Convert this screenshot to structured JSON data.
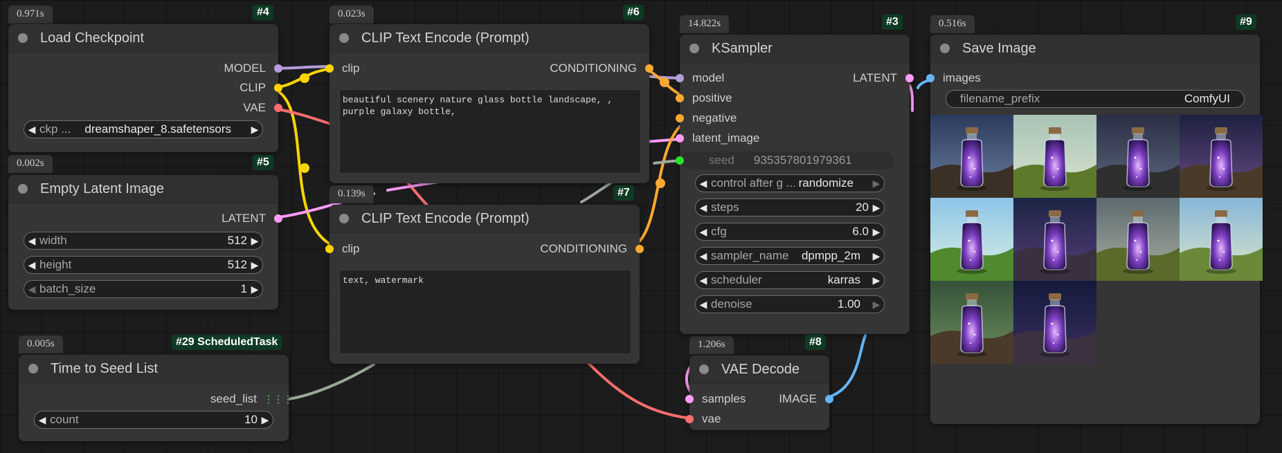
{
  "colors": {
    "model": "#b39ddb",
    "clip": "#ffd500",
    "vae": "#ff6e6e",
    "latent": "#ff9cf9",
    "conditioning": "#ffa931",
    "image": "#64b5f6",
    "int": "#29a329",
    "seedlist": "#4caf50"
  },
  "nodes": {
    "load_checkpoint": {
      "time": "0.971s",
      "id": "#4",
      "title": "Load Checkpoint",
      "outputs": [
        "MODEL",
        "CLIP",
        "VAE"
      ],
      "ckpt_name": "ckp ...",
      "ckpt_value": "dreamshaper_8.safetensors"
    },
    "empty_latent": {
      "time": "0.002s",
      "id": "#5",
      "title": "Empty Latent Image",
      "output": "LATENT",
      "widgets": [
        {
          "name": "width",
          "value": "512"
        },
        {
          "name": "height",
          "value": "512"
        },
        {
          "name": "batch_size",
          "value": "1"
        }
      ]
    },
    "time_to_seed": {
      "time": "0.005s",
      "id": "#29 ScheduledTask",
      "title": "Time to Seed List",
      "output": "seed_list",
      "widget": {
        "name": "count",
        "value": "10"
      }
    },
    "clip_pos": {
      "time": "0.023s",
      "id": "#6",
      "title": "CLIP Text Encode (Prompt)",
      "input": "clip",
      "output": "CONDITIONING",
      "text": "beautiful scenery nature glass bottle landscape, ,\npurple galaxy bottle,"
    },
    "clip_neg": {
      "time": "0.139s",
      "id": "#7",
      "title": "CLIP Text Encode (Prompt)",
      "input": "clip",
      "output": "CONDITIONING",
      "text": "text, watermark"
    },
    "ksampler": {
      "time": "14.822s",
      "id": "#3",
      "title": "KSampler",
      "inputs": [
        "model",
        "positive",
        "negative",
        "latent_image"
      ],
      "output": "LATENT",
      "seed": {
        "name": "seed",
        "value": "935357801979361"
      },
      "widgets": [
        {
          "name": "control after g ...",
          "value": "randomize"
        },
        {
          "name": "steps",
          "value": "20"
        },
        {
          "name": "cfg",
          "value": "6.0"
        },
        {
          "name": "sampler_name",
          "value": "dpmpp_2m"
        },
        {
          "name": "scheduler",
          "value": "karras"
        },
        {
          "name": "denoise",
          "value": "1.00"
        }
      ]
    },
    "vae_decode": {
      "time": "1.206s",
      "id": "#8",
      "title": "VAE Decode",
      "inputs": [
        "samples",
        "vae"
      ],
      "output": "IMAGE"
    },
    "save_image": {
      "time": "0.516s",
      "id": "#9",
      "title": "Save Image",
      "input": "images",
      "filename_prefix": {
        "name": "filename_prefix",
        "value": "ComfyUI"
      },
      "thumbnail_count": 10
    }
  }
}
